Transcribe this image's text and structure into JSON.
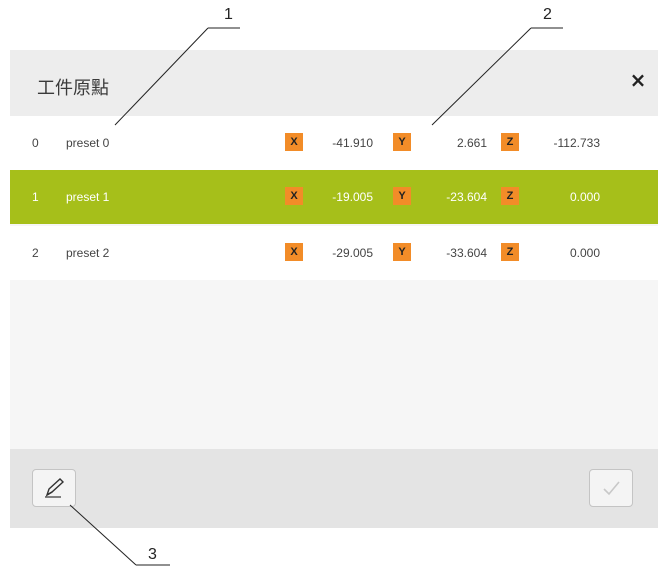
{
  "dialog": {
    "title": "工件原點",
    "close_label": "×"
  },
  "presets": [
    {
      "index": "0",
      "name": "preset 0",
      "x_label": "X",
      "x": "-41.910",
      "y_label": "Y",
      "y": "2.661",
      "z_label": "Z",
      "z": "-112.733",
      "selected": false
    },
    {
      "index": "1",
      "name": "preset 1",
      "x_label": "X",
      "x": "-19.005",
      "y_label": "Y",
      "y": "-23.604",
      "z_label": "Z",
      "z": "0.000",
      "selected": true
    },
    {
      "index": "2",
      "name": "preset 2",
      "x_label": "X",
      "x": "-29.005",
      "y_label": "Y",
      "y": "-33.604",
      "z_label": "Z",
      "z": "0.000",
      "selected": false
    }
  ],
  "callouts": [
    "1",
    "2",
    "3"
  ],
  "colors": {
    "selected_row": "#a6bf1a",
    "axis_badge": "#f28c28"
  },
  "icons": {
    "edit": "pencil-icon",
    "confirm": "check-icon"
  }
}
